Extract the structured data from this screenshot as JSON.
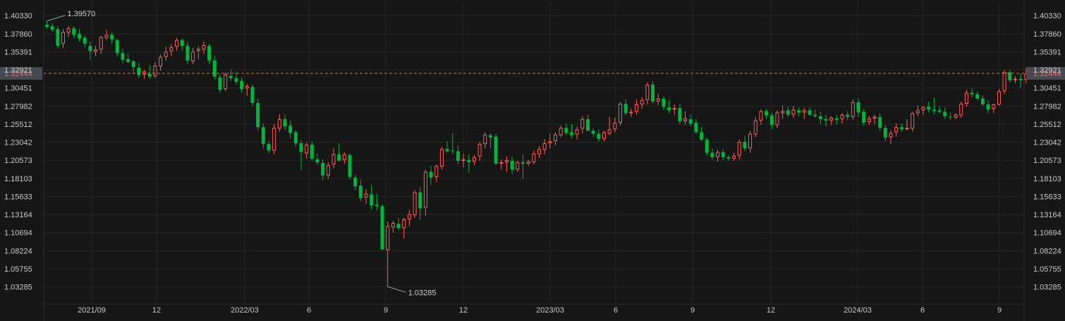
{
  "chart_data": {
    "type": "candlestick",
    "x_tick_labels": [
      "2021/09",
      "12",
      "2022/03",
      "6",
      "9",
      "12",
      "2023/03",
      "6",
      "9",
      "12",
      "2024/03",
      "6",
      "9"
    ],
    "y_tick_labels": [
      "1.40330",
      "1.37860",
      "1.35391",
      "1.32921",
      "1.30451",
      "1.27982",
      "1.25512",
      "1.23042",
      "1.20573",
      "1.18103",
      "1.15633",
      "1.13164",
      "1.10694",
      "1.08224",
      "1.05755",
      "1.03285"
    ],
    "ylim": [
      1.0093,
      1.4218
    ],
    "current_price": "1.32444",
    "annotations": {
      "high": "1.39570",
      "low": "1.03285"
    },
    "grid": true,
    "colors": {
      "up": "#ff5d5d",
      "down": "#00b43c",
      "grid": "#262626",
      "background": "#161616",
      "current_line": "#e0703a",
      "current_badge": "#454a52"
    },
    "candles": [
      {
        "o": 1.391,
        "h": 1.396,
        "l": 1.385,
        "c": 1.388
      },
      {
        "o": 1.389,
        "h": 1.393,
        "l": 1.381,
        "c": 1.384
      },
      {
        "o": 1.385,
        "h": 1.389,
        "l": 1.358,
        "c": 1.362
      },
      {
        "o": 1.365,
        "h": 1.385,
        "l": 1.359,
        "c": 1.381
      },
      {
        "o": 1.38,
        "h": 1.389,
        "l": 1.374,
        "c": 1.386
      },
      {
        "o": 1.386,
        "h": 1.389,
        "l": 1.372,
        "c": 1.377
      },
      {
        "o": 1.378,
        "h": 1.385,
        "l": 1.368,
        "c": 1.372
      },
      {
        "o": 1.373,
        "h": 1.376,
        "l": 1.36,
        "c": 1.365
      },
      {
        "o": 1.362,
        "h": 1.368,
        "l": 1.343,
        "c": 1.355
      },
      {
        "o": 1.354,
        "h": 1.362,
        "l": 1.348,
        "c": 1.357
      },
      {
        "o": 1.357,
        "h": 1.376,
        "l": 1.351,
        "c": 1.374
      },
      {
        "o": 1.373,
        "h": 1.384,
        "l": 1.37,
        "c": 1.377
      },
      {
        "o": 1.377,
        "h": 1.38,
        "l": 1.365,
        "c": 1.371
      },
      {
        "o": 1.37,
        "h": 1.372,
        "l": 1.347,
        "c": 1.352
      },
      {
        "o": 1.352,
        "h": 1.358,
        "l": 1.338,
        "c": 1.343
      },
      {
        "o": 1.344,
        "h": 1.351,
        "l": 1.338,
        "c": 1.34
      },
      {
        "o": 1.341,
        "h": 1.343,
        "l": 1.325,
        "c": 1.333
      },
      {
        "o": 1.332,
        "h": 1.339,
        "l": 1.318,
        "c": 1.322
      },
      {
        "o": 1.323,
        "h": 1.329,
        "l": 1.317,
        "c": 1.327
      },
      {
        "o": 1.324,
        "h": 1.336,
        "l": 1.317,
        "c": 1.32
      },
      {
        "o": 1.321,
        "h": 1.34,
        "l": 1.318,
        "c": 1.335
      },
      {
        "o": 1.334,
        "h": 1.35,
        "l": 1.328,
        "c": 1.347
      },
      {
        "o": 1.347,
        "h": 1.361,
        "l": 1.342,
        "c": 1.354
      },
      {
        "o": 1.355,
        "h": 1.364,
        "l": 1.348,
        "c": 1.36
      },
      {
        "o": 1.361,
        "h": 1.373,
        "l": 1.356,
        "c": 1.37
      },
      {
        "o": 1.37,
        "h": 1.372,
        "l": 1.356,
        "c": 1.362
      },
      {
        "o": 1.362,
        "h": 1.368,
        "l": 1.337,
        "c": 1.342
      },
      {
        "o": 1.341,
        "h": 1.359,
        "l": 1.337,
        "c": 1.354
      },
      {
        "o": 1.355,
        "h": 1.362,
        "l": 1.344,
        "c": 1.358
      },
      {
        "o": 1.357,
        "h": 1.368,
        "l": 1.351,
        "c": 1.363
      },
      {
        "o": 1.362,
        "h": 1.365,
        "l": 1.337,
        "c": 1.342
      },
      {
        "o": 1.342,
        "h": 1.349,
        "l": 1.316,
        "c": 1.32
      },
      {
        "o": 1.319,
        "h": 1.324,
        "l": 1.298,
        "c": 1.302
      },
      {
        "o": 1.303,
        "h": 1.326,
        "l": 1.3,
        "c": 1.323
      },
      {
        "o": 1.321,
        "h": 1.33,
        "l": 1.314,
        "c": 1.318
      },
      {
        "o": 1.318,
        "h": 1.327,
        "l": 1.309,
        "c": 1.313
      },
      {
        "o": 1.314,
        "h": 1.319,
        "l": 1.298,
        "c": 1.303
      },
      {
        "o": 1.304,
        "h": 1.31,
        "l": 1.294,
        "c": 1.307
      },
      {
        "o": 1.306,
        "h": 1.309,
        "l": 1.28,
        "c": 1.284
      },
      {
        "o": 1.284,
        "h": 1.29,
        "l": 1.246,
        "c": 1.251
      },
      {
        "o": 1.251,
        "h": 1.256,
        "l": 1.222,
        "c": 1.228
      },
      {
        "o": 1.228,
        "h": 1.232,
        "l": 1.215,
        "c": 1.219
      },
      {
        "o": 1.219,
        "h": 1.255,
        "l": 1.214,
        "c": 1.25
      },
      {
        "o": 1.249,
        "h": 1.269,
        "l": 1.245,
        "c": 1.262
      },
      {
        "o": 1.262,
        "h": 1.268,
        "l": 1.247,
        "c": 1.252
      },
      {
        "o": 1.253,
        "h": 1.26,
        "l": 1.236,
        "c": 1.243
      },
      {
        "o": 1.244,
        "h": 1.247,
        "l": 1.224,
        "c": 1.229
      },
      {
        "o": 1.229,
        "h": 1.233,
        "l": 1.192,
        "c": 1.217
      },
      {
        "o": 1.215,
        "h": 1.23,
        "l": 1.208,
        "c": 1.227
      },
      {
        "o": 1.227,
        "h": 1.232,
        "l": 1.205,
        "c": 1.208
      },
      {
        "o": 1.207,
        "h": 1.215,
        "l": 1.199,
        "c": 1.203
      },
      {
        "o": 1.202,
        "h": 1.207,
        "l": 1.178,
        "c": 1.185
      },
      {
        "o": 1.185,
        "h": 1.203,
        "l": 1.18,
        "c": 1.199
      },
      {
        "o": 1.2,
        "h": 1.222,
        "l": 1.195,
        "c": 1.214
      },
      {
        "o": 1.214,
        "h": 1.229,
        "l": 1.205,
        "c": 1.205
      },
      {
        "o": 1.206,
        "h": 1.217,
        "l": 1.201,
        "c": 1.214
      },
      {
        "o": 1.213,
        "h": 1.215,
        "l": 1.18,
        "c": 1.183
      },
      {
        "o": 1.182,
        "h": 1.186,
        "l": 1.165,
        "c": 1.17
      },
      {
        "o": 1.171,
        "h": 1.179,
        "l": 1.15,
        "c": 1.154
      },
      {
        "o": 1.155,
        "h": 1.166,
        "l": 1.146,
        "c": 1.16
      },
      {
        "o": 1.159,
        "h": 1.172,
        "l": 1.138,
        "c": 1.144
      },
      {
        "o": 1.145,
        "h": 1.16,
        "l": 1.137,
        "c": 1.143
      },
      {
        "o": 1.143,
        "h": 1.146,
        "l": 1.083,
        "c": 1.084
      },
      {
        "o": 1.083,
        "h": 1.122,
        "l": 1.033,
        "c": 1.116
      },
      {
        "o": 1.114,
        "h": 1.123,
        "l": 1.107,
        "c": 1.12
      },
      {
        "o": 1.119,
        "h": 1.127,
        "l": 1.11,
        "c": 1.113
      },
      {
        "o": 1.113,
        "h": 1.127,
        "l": 1.099,
        "c": 1.125
      },
      {
        "o": 1.125,
        "h": 1.138,
        "l": 1.116,
        "c": 1.132
      },
      {
        "o": 1.131,
        "h": 1.165,
        "l": 1.127,
        "c": 1.162
      },
      {
        "o": 1.162,
        "h": 1.169,
        "l": 1.124,
        "c": 1.14
      },
      {
        "o": 1.141,
        "h": 1.193,
        "l": 1.13,
        "c": 1.19
      },
      {
        "o": 1.19,
        "h": 1.198,
        "l": 1.172,
        "c": 1.182
      },
      {
        "o": 1.183,
        "h": 1.2,
        "l": 1.176,
        "c": 1.198
      },
      {
        "o": 1.197,
        "h": 1.224,
        "l": 1.193,
        "c": 1.221
      },
      {
        "o": 1.221,
        "h": 1.232,
        "l": 1.216,
        "c": 1.218
      },
      {
        "o": 1.219,
        "h": 1.243,
        "l": 1.214,
        "c": 1.218
      },
      {
        "o": 1.218,
        "h": 1.226,
        "l": 1.2,
        "c": 1.205
      },
      {
        "o": 1.205,
        "h": 1.215,
        "l": 1.196,
        "c": 1.207
      },
      {
        "o": 1.206,
        "h": 1.214,
        "l": 1.189,
        "c": 1.203
      },
      {
        "o": 1.204,
        "h": 1.213,
        "l": 1.199,
        "c": 1.21
      },
      {
        "o": 1.211,
        "h": 1.231,
        "l": 1.205,
        "c": 1.228
      },
      {
        "o": 1.228,
        "h": 1.244,
        "l": 1.222,
        "c": 1.241
      },
      {
        "o": 1.24,
        "h": 1.243,
        "l": 1.222,
        "c": 1.237
      },
      {
        "o": 1.238,
        "h": 1.242,
        "l": 1.199,
        "c": 1.201
      },
      {
        "o": 1.201,
        "h": 1.207,
        "l": 1.193,
        "c": 1.203
      },
      {
        "o": 1.203,
        "h": 1.211,
        "l": 1.19,
        "c": 1.206
      },
      {
        "o": 1.205,
        "h": 1.211,
        "l": 1.187,
        "c": 1.193
      },
      {
        "o": 1.193,
        "h": 1.205,
        "l": 1.19,
        "c": 1.203
      },
      {
        "o": 1.203,
        "h": 1.214,
        "l": 1.18,
        "c": 1.201
      },
      {
        "o": 1.201,
        "h": 1.206,
        "l": 1.198,
        "c": 1.204
      },
      {
        "o": 1.203,
        "h": 1.219,
        "l": 1.2,
        "c": 1.215
      },
      {
        "o": 1.214,
        "h": 1.225,
        "l": 1.209,
        "c": 1.221
      },
      {
        "o": 1.22,
        "h": 1.235,
        "l": 1.214,
        "c": 1.229
      },
      {
        "o": 1.229,
        "h": 1.242,
        "l": 1.222,
        "c": 1.232
      },
      {
        "o": 1.232,
        "h": 1.244,
        "l": 1.226,
        "c": 1.241
      },
      {
        "o": 1.24,
        "h": 1.253,
        "l": 1.237,
        "c": 1.25
      },
      {
        "o": 1.25,
        "h": 1.256,
        "l": 1.24,
        "c": 1.243
      },
      {
        "o": 1.244,
        "h": 1.255,
        "l": 1.236,
        "c": 1.24
      },
      {
        "o": 1.241,
        "h": 1.252,
        "l": 1.234,
        "c": 1.248
      },
      {
        "o": 1.249,
        "h": 1.266,
        "l": 1.242,
        "c": 1.262
      },
      {
        "o": 1.262,
        "h": 1.268,
        "l": 1.246,
        "c": 1.246
      },
      {
        "o": 1.246,
        "h": 1.249,
        "l": 1.238,
        "c": 1.242
      },
      {
        "o": 1.242,
        "h": 1.248,
        "l": 1.231,
        "c": 1.235
      },
      {
        "o": 1.235,
        "h": 1.246,
        "l": 1.232,
        "c": 1.244
      },
      {
        "o": 1.242,
        "h": 1.265,
        "l": 1.24,
        "c": 1.248
      },
      {
        "o": 1.248,
        "h": 1.264,
        "l": 1.244,
        "c": 1.257
      },
      {
        "o": 1.257,
        "h": 1.285,
        "l": 1.253,
        "c": 1.283
      },
      {
        "o": 1.283,
        "h": 1.289,
        "l": 1.267,
        "c": 1.27
      },
      {
        "o": 1.271,
        "h": 1.276,
        "l": 1.265,
        "c": 1.272
      },
      {
        "o": 1.272,
        "h": 1.289,
        "l": 1.268,
        "c": 1.282
      },
      {
        "o": 1.282,
        "h": 1.292,
        "l": 1.276,
        "c": 1.288
      },
      {
        "o": 1.288,
        "h": 1.312,
        "l": 1.282,
        "c": 1.309
      },
      {
        "o": 1.309,
        "h": 1.314,
        "l": 1.283,
        "c": 1.286
      },
      {
        "o": 1.286,
        "h": 1.297,
        "l": 1.281,
        "c": 1.29
      },
      {
        "o": 1.29,
        "h": 1.293,
        "l": 1.274,
        "c": 1.279
      },
      {
        "o": 1.278,
        "h": 1.288,
        "l": 1.27,
        "c": 1.274
      },
      {
        "o": 1.275,
        "h": 1.282,
        "l": 1.268,
        "c": 1.277
      },
      {
        "o": 1.277,
        "h": 1.283,
        "l": 1.255,
        "c": 1.259
      },
      {
        "o": 1.259,
        "h": 1.273,
        "l": 1.254,
        "c": 1.263
      },
      {
        "o": 1.262,
        "h": 1.268,
        "l": 1.252,
        "c": 1.256
      },
      {
        "o": 1.257,
        "h": 1.262,
        "l": 1.242,
        "c": 1.244
      },
      {
        "o": 1.244,
        "h": 1.251,
        "l": 1.232,
        "c": 1.234
      },
      {
        "o": 1.234,
        "h": 1.237,
        "l": 1.212,
        "c": 1.216
      },
      {
        "o": 1.216,
        "h": 1.222,
        "l": 1.207,
        "c": 1.21
      },
      {
        "o": 1.21,
        "h": 1.22,
        "l": 1.204,
        "c": 1.217
      },
      {
        "o": 1.217,
        "h": 1.221,
        "l": 1.206,
        "c": 1.21
      },
      {
        "o": 1.21,
        "h": 1.213,
        "l": 1.205,
        "c": 1.208
      },
      {
        "o": 1.208,
        "h": 1.216,
        "l": 1.205,
        "c": 1.212
      },
      {
        "o": 1.212,
        "h": 1.234,
        "l": 1.207,
        "c": 1.231
      },
      {
        "o": 1.231,
        "h": 1.239,
        "l": 1.218,
        "c": 1.222
      },
      {
        "o": 1.222,
        "h": 1.246,
        "l": 1.216,
        "c": 1.242
      },
      {
        "o": 1.241,
        "h": 1.265,
        "l": 1.237,
        "c": 1.26
      },
      {
        "o": 1.26,
        "h": 1.275,
        "l": 1.254,
        "c": 1.273
      },
      {
        "o": 1.273,
        "h": 1.276,
        "l": 1.262,
        "c": 1.267
      },
      {
        "o": 1.267,
        "h": 1.271,
        "l": 1.248,
        "c": 1.254
      },
      {
        "o": 1.254,
        "h": 1.274,
        "l": 1.25,
        "c": 1.271
      },
      {
        "o": 1.27,
        "h": 1.281,
        "l": 1.262,
        "c": 1.273
      },
      {
        "o": 1.274,
        "h": 1.279,
        "l": 1.265,
        "c": 1.268
      },
      {
        "o": 1.268,
        "h": 1.28,
        "l": 1.264,
        "c": 1.275
      },
      {
        "o": 1.274,
        "h": 1.278,
        "l": 1.266,
        "c": 1.271
      },
      {
        "o": 1.271,
        "h": 1.277,
        "l": 1.262,
        "c": 1.274
      },
      {
        "o": 1.274,
        "h": 1.278,
        "l": 1.266,
        "c": 1.268
      },
      {
        "o": 1.268,
        "h": 1.275,
        "l": 1.264,
        "c": 1.266
      },
      {
        "o": 1.266,
        "h": 1.272,
        "l": 1.255,
        "c": 1.262
      },
      {
        "o": 1.262,
        "h": 1.268,
        "l": 1.252,
        "c": 1.26
      },
      {
        "o": 1.26,
        "h": 1.266,
        "l": 1.254,
        "c": 1.264
      },
      {
        "o": 1.263,
        "h": 1.268,
        "l": 1.255,
        "c": 1.261
      },
      {
        "o": 1.262,
        "h": 1.27,
        "l": 1.256,
        "c": 1.268
      },
      {
        "o": 1.268,
        "h": 1.273,
        "l": 1.261,
        "c": 1.265
      },
      {
        "o": 1.265,
        "h": 1.289,
        "l": 1.261,
        "c": 1.285
      },
      {
        "o": 1.285,
        "h": 1.29,
        "l": 1.265,
        "c": 1.271
      },
      {
        "o": 1.272,
        "h": 1.276,
        "l": 1.252,
        "c": 1.257
      },
      {
        "o": 1.258,
        "h": 1.266,
        "l": 1.254,
        "c": 1.263
      },
      {
        "o": 1.263,
        "h": 1.268,
        "l": 1.255,
        "c": 1.265
      },
      {
        "o": 1.265,
        "h": 1.27,
        "l": 1.246,
        "c": 1.25
      },
      {
        "o": 1.25,
        "h": 1.254,
        "l": 1.232,
        "c": 1.237
      },
      {
        "o": 1.237,
        "h": 1.247,
        "l": 1.228,
        "c": 1.243
      },
      {
        "o": 1.244,
        "h": 1.256,
        "l": 1.238,
        "c": 1.251
      },
      {
        "o": 1.251,
        "h": 1.256,
        "l": 1.245,
        "c": 1.248
      },
      {
        "o": 1.248,
        "h": 1.262,
        "l": 1.247,
        "c": 1.25
      },
      {
        "o": 1.249,
        "h": 1.272,
        "l": 1.245,
        "c": 1.27
      },
      {
        "o": 1.27,
        "h": 1.281,
        "l": 1.266,
        "c": 1.274
      },
      {
        "o": 1.274,
        "h": 1.28,
        "l": 1.268,
        "c": 1.278
      },
      {
        "o": 1.279,
        "h": 1.286,
        "l": 1.271,
        "c": 1.275
      },
      {
        "o": 1.275,
        "h": 1.292,
        "l": 1.268,
        "c": 1.273
      },
      {
        "o": 1.274,
        "h": 1.28,
        "l": 1.27,
        "c": 1.272
      },
      {
        "o": 1.272,
        "h": 1.278,
        "l": 1.262,
        "c": 1.266
      },
      {
        "o": 1.265,
        "h": 1.271,
        "l": 1.261,
        "c": 1.264
      },
      {
        "o": 1.264,
        "h": 1.27,
        "l": 1.262,
        "c": 1.268
      },
      {
        "o": 1.267,
        "h": 1.286,
        "l": 1.264,
        "c": 1.283
      },
      {
        "o": 1.283,
        "h": 1.302,
        "l": 1.279,
        "c": 1.298
      },
      {
        "o": 1.298,
        "h": 1.304,
        "l": 1.292,
        "c": 1.296
      },
      {
        "o": 1.296,
        "h": 1.3,
        "l": 1.288,
        "c": 1.29
      },
      {
        "o": 1.29,
        "h": 1.294,
        "l": 1.28,
        "c": 1.282
      },
      {
        "o": 1.282,
        "h": 1.288,
        "l": 1.27,
        "c": 1.275
      },
      {
        "o": 1.276,
        "h": 1.283,
        "l": 1.27,
        "c": 1.282
      },
      {
        "o": 1.282,
        "h": 1.303,
        "l": 1.28,
        "c": 1.3
      },
      {
        "o": 1.3,
        "h": 1.329,
        "l": 1.296,
        "c": 1.326
      },
      {
        "o": 1.326,
        "h": 1.329,
        "l": 1.312,
        "c": 1.315
      },
      {
        "o": 1.316,
        "h": 1.321,
        "l": 1.311,
        "c": 1.317
      },
      {
        "o": 1.317,
        "h": 1.324,
        "l": 1.305,
        "c": 1.315
      },
      {
        "o": 1.316,
        "h": 1.331,
        "l": 1.311,
        "c": 1.324
      }
    ]
  }
}
